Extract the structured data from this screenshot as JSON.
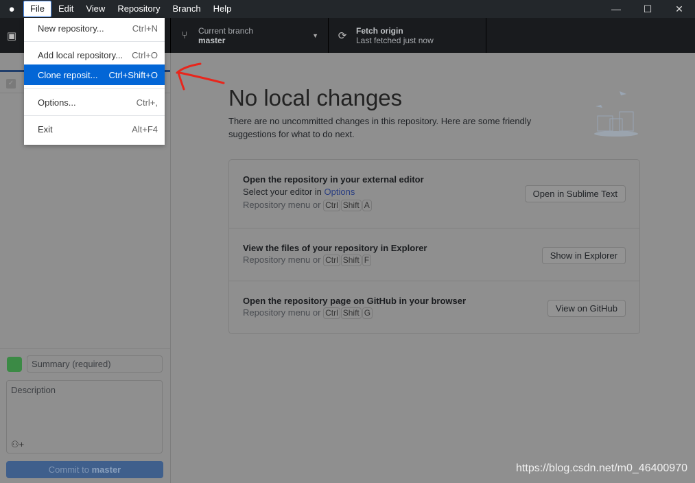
{
  "menubar": {
    "items": [
      "File",
      "Edit",
      "View",
      "Repository",
      "Branch",
      "Help"
    ],
    "active": "File"
  },
  "file_menu": {
    "items": [
      {
        "label": "New repository...",
        "shortcut": "Ctrl+N"
      },
      {
        "label": "Add local repository...",
        "shortcut": "Ctrl+O"
      },
      {
        "label": "Clone reposit...",
        "shortcut": "Ctrl+Shift+O"
      },
      {
        "label": "Options...",
        "shortcut": "Ctrl+,"
      },
      {
        "label": "Exit",
        "shortcut": "Alt+F4"
      }
    ],
    "highlighted": "Clone reposit..."
  },
  "toolbar": {
    "branch_label": "Current branch",
    "branch": "master",
    "fetch_title": "Fetch origin",
    "fetch_sub": "Last fetched just now"
  },
  "commit": {
    "summary_placeholder": "Summary (required)",
    "description_placeholder": "Description",
    "button_prefix": "Commit to ",
    "button_branch": "master"
  },
  "main": {
    "title": "No local changes",
    "lead": "There are no uncommitted changes in this repository. Here are some friendly suggestions for what to do next.",
    "rows": [
      {
        "title": "Open the repository in your external editor",
        "sub_prefix": "Select your editor in ",
        "sub_link": "Options",
        "hint": "Repository menu or",
        "keys": [
          "Ctrl",
          "Shift",
          "A"
        ],
        "button": "Open in Sublime Text"
      },
      {
        "title": "View the files of your repository in Explorer",
        "hint": "Repository menu or",
        "keys": [
          "Ctrl",
          "Shift",
          "F"
        ],
        "button": "Show in Explorer"
      },
      {
        "title": "Open the repository page on GitHub in your browser",
        "hint": "Repository menu or",
        "keys": [
          "Ctrl",
          "Shift",
          "G"
        ],
        "button": "View on GitHub"
      }
    ]
  },
  "watermark": "https://blog.csdn.net/m0_46400970",
  "colors": {
    "accent": "#0366d6",
    "annotation_arrow": "#e8261c"
  }
}
